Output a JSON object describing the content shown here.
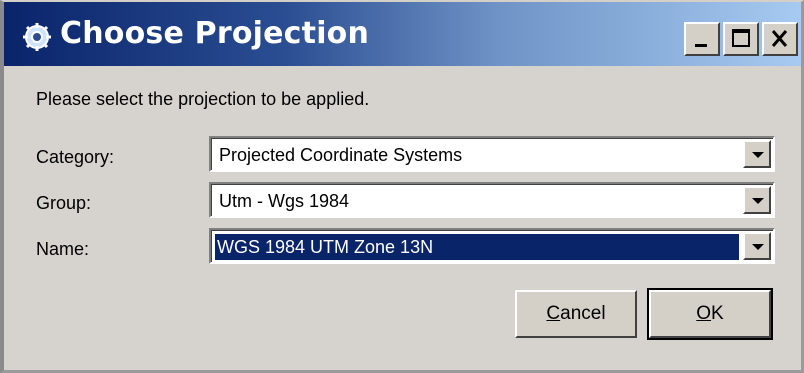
{
  "window": {
    "title": "Choose Projection",
    "title_icon": "globe-gear-icon",
    "controls": [
      "minimize-icon",
      "maximize-icon",
      "close-icon"
    ]
  },
  "prompt": "Please select the projection to be applied.",
  "fields": {
    "category": {
      "label": "Category:",
      "value": "Projected Coordinate Systems"
    },
    "group": {
      "label": "Group:",
      "value": "Utm - Wgs 1984"
    },
    "name": {
      "label": "Name:",
      "value": "WGS 1984 UTM Zone 13N"
    }
  },
  "buttons": {
    "cancel": {
      "mnemonic": "C",
      "rest": "ancel"
    },
    "ok": {
      "mnemonic": "O",
      "rest": "K"
    }
  },
  "colors": {
    "title_gradient_start": "#0a246a",
    "title_gradient_end": "#a6caf0",
    "selection": "#0a246a",
    "dialog_bg": "#d6d3ce"
  }
}
